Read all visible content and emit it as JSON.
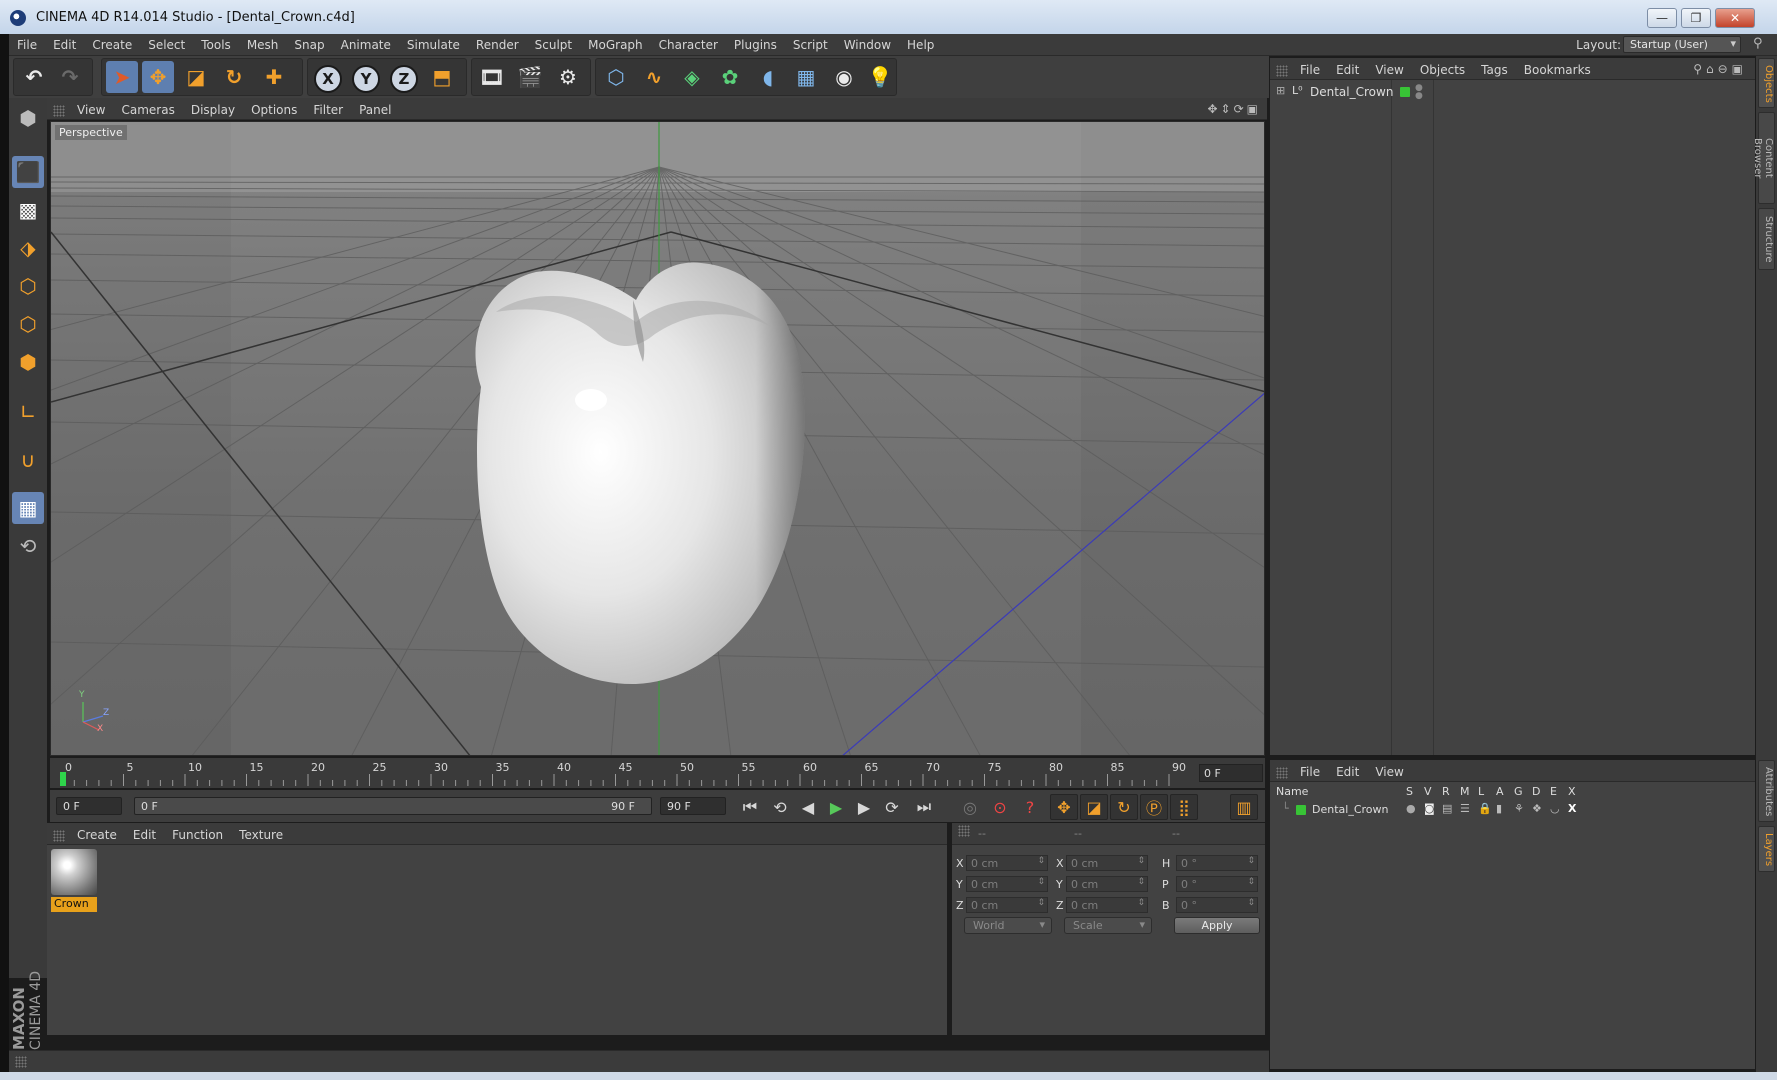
{
  "window": {
    "title": "CINEMA 4D R14.014 Studio - [Dental_Crown.c4d]",
    "minimize": "—",
    "restore": "❐",
    "close": "✕"
  },
  "menubar": {
    "items": [
      "File",
      "Edit",
      "Create",
      "Select",
      "Tools",
      "Mesh",
      "Snap",
      "Animate",
      "Simulate",
      "Render",
      "Sculpt",
      "MoGraph",
      "Character",
      "Plugins",
      "Script",
      "Window",
      "Help"
    ],
    "layout_label": "Layout:",
    "layout_value": "Startup (User)"
  },
  "viewport": {
    "menu": [
      "View",
      "Cameras",
      "Display",
      "Options",
      "Filter",
      "Panel"
    ],
    "label": "Perspective",
    "axis_y": "Y",
    "axis_z": "Z",
    "axis_x": "X"
  },
  "timeline": {
    "ticks": [
      "0",
      "5",
      "10",
      "15",
      "20",
      "25",
      "30",
      "35",
      "40",
      "45",
      "50",
      "55",
      "60",
      "65",
      "70",
      "75",
      "80",
      "85",
      "90"
    ],
    "current_frame": "0 F",
    "start_field": "0 F",
    "range_start": "0 F",
    "range_end": "90 F",
    "end_field": "90 F"
  },
  "materials": {
    "menu": [
      "Create",
      "Edit",
      "Function",
      "Texture"
    ],
    "items": [
      {
        "name": "Crown"
      }
    ]
  },
  "coordinates": {
    "headers": [
      "--",
      "--",
      "--"
    ],
    "rows": [
      {
        "l1": "X",
        "v1": "0 cm",
        "l2": "X",
        "v2": "0 cm",
        "l3": "H",
        "v3": "0 °"
      },
      {
        "l1": "Y",
        "v1": "0 cm",
        "l2": "Y",
        "v2": "0 cm",
        "l3": "P",
        "v3": "0 °"
      },
      {
        "l1": "Z",
        "v1": "0 cm",
        "l2": "Z",
        "v2": "0 cm",
        "l3": "B",
        "v3": "0 °"
      }
    ],
    "mode": "World",
    "scale": "Scale",
    "apply": "Apply"
  },
  "object_manager": {
    "menu": [
      "File",
      "Edit",
      "View",
      "Objects",
      "Tags",
      "Bookmarks"
    ],
    "objects": [
      {
        "name": "Dental_Crown",
        "color": "#38c436"
      }
    ]
  },
  "layer_manager": {
    "menu": [
      "File",
      "Edit",
      "View"
    ],
    "columns": [
      "Name",
      "S",
      "V",
      "R",
      "M",
      "L",
      "A",
      "G",
      "D",
      "E",
      "X"
    ],
    "rows": [
      {
        "name": "Dental_Crown",
        "color": "#38c436"
      }
    ]
  },
  "right_tabs": [
    "Objects",
    "Content Browser",
    "Structure",
    "Attributes",
    "Layers"
  ],
  "branding": {
    "maxon": "MAXON",
    "product": "CINEMA 4D"
  }
}
